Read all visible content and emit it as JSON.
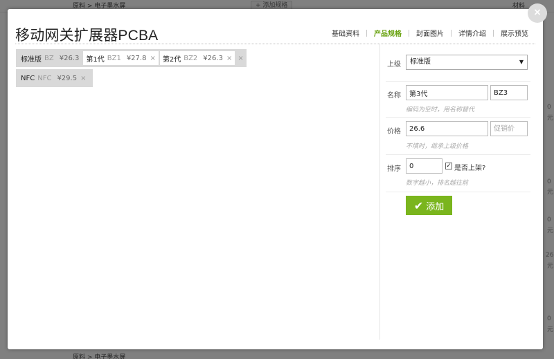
{
  "background": {
    "rows": [
      {
        "a": "原料 > 电子墨水屏",
        "b": "材料"
      },
      {
        "a": "原料 > 电子墨水屏",
        "b": ""
      }
    ],
    "add_spec_label": "+ 添加规格",
    "side_values": [
      "0",
      "元",
      "0",
      "元",
      "0",
      "元",
      "26",
      "元",
      "0",
      "元"
    ]
  },
  "modal": {
    "close_symbol": "×",
    "title": "移动网关扩展器PCBA",
    "tabs": [
      {
        "label": "基础资料",
        "active": false
      },
      {
        "label": "产品规格",
        "active": true
      },
      {
        "label": "封面图片",
        "active": false
      },
      {
        "label": "详情介绍",
        "active": false
      },
      {
        "label": "展示预览",
        "active": false
      }
    ],
    "spec_groups": [
      {
        "items": [
          {
            "name": "标准版",
            "code": "BZ",
            "price": "¥26.3",
            "highlight": false
          },
          {
            "name": "第1代",
            "code": "BZ1",
            "price": "¥27.8",
            "highlight": true
          },
          {
            "name": "第2代",
            "code": "BZ2",
            "price": "¥26.3",
            "highlight": true
          }
        ]
      },
      {
        "items": [
          {
            "name": "NFC",
            "code": "NFC",
            "price": "¥29.5",
            "highlight": false
          }
        ]
      }
    ],
    "remove_symbol": "×",
    "form": {
      "parent_label": "上级",
      "parent_value": "标准版",
      "name_label": "名称",
      "name_value": "第3代",
      "code_value": "BZ3",
      "name_hint": "编码为空时，用名称替代",
      "price_label": "价格",
      "price_value": "26.6",
      "promo_placeholder": "促销价",
      "price_hint": "不填时，继承上级价格",
      "sort_label": "排序",
      "sort_value": "0",
      "listed_label": "是否上架?",
      "listed_checked": "✓",
      "sort_hint": "数字越小，排名越往前",
      "add_label": "添加",
      "add_icon": "✔"
    }
  },
  "colors": {
    "accent": "#7ab51d",
    "active_tab": "#6aa311"
  }
}
